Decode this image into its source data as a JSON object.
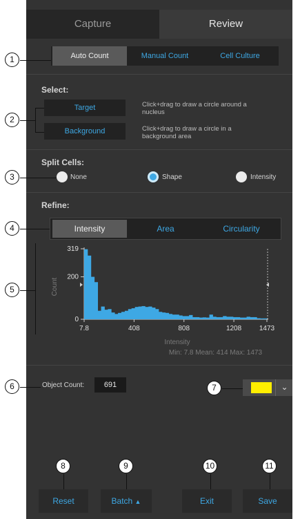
{
  "tabs": {
    "capture": "Capture",
    "review": "Review"
  },
  "modes": [
    "Auto Count",
    "Manual Count",
    "Cell Culture"
  ],
  "select": {
    "label": "Select:",
    "target_label": "Target",
    "target_hint": [
      "Click+drag to draw a circle around a",
      "nucleus"
    ],
    "background_label": "Background",
    "background_hint": [
      "Click+drag to draw a circle in a",
      "background area"
    ]
  },
  "split": {
    "label": "Split Cells:",
    "options": [
      "None",
      "Shape",
      "Intensity"
    ],
    "selected": "Shape"
  },
  "refine": {
    "label": "Refine:",
    "tabs": [
      "Intensity",
      "Area",
      "Circularity"
    ],
    "selected": "Intensity"
  },
  "histogram": {
    "stats": "Min: 7.8   Mean: 414   Max: 1473"
  },
  "chart_data": {
    "type": "bar",
    "xlabel": "Intensity",
    "ylabel": "Count",
    "xlim": [
      7.8,
      1473
    ],
    "ylim": [
      0,
      319
    ],
    "x_ticks": [
      "7.8",
      "408",
      "808",
      "1208",
      "1473"
    ],
    "y_ticks": [
      "0",
      "200",
      "319"
    ],
    "values": [
      330,
      300,
      200,
      175,
      40,
      60,
      45,
      48,
      32,
      25,
      30,
      35,
      40,
      48,
      52,
      58,
      60,
      62,
      58,
      60,
      55,
      48,
      35,
      32,
      30,
      25,
      22,
      22,
      18,
      15,
      15,
      20,
      10,
      10,
      8,
      9,
      8,
      22,
      12,
      10,
      10,
      15,
      12,
      12,
      10,
      10,
      8,
      8,
      12,
      10,
      10,
      5,
      4,
      4
    ]
  },
  "object_count": {
    "label": "Object Count:",
    "value": "691"
  },
  "color_swatch": "#ffee00",
  "callouts": [
    "1",
    "2",
    "3",
    "4",
    "5",
    "6",
    "7",
    "8",
    "9",
    "10",
    "11"
  ],
  "bottom": {
    "reset": "Reset",
    "batch": "Batch",
    "exit": "Exit",
    "save": "Save"
  },
  "colors": {
    "accent": "#3ea8e4",
    "panel": "#333333"
  }
}
